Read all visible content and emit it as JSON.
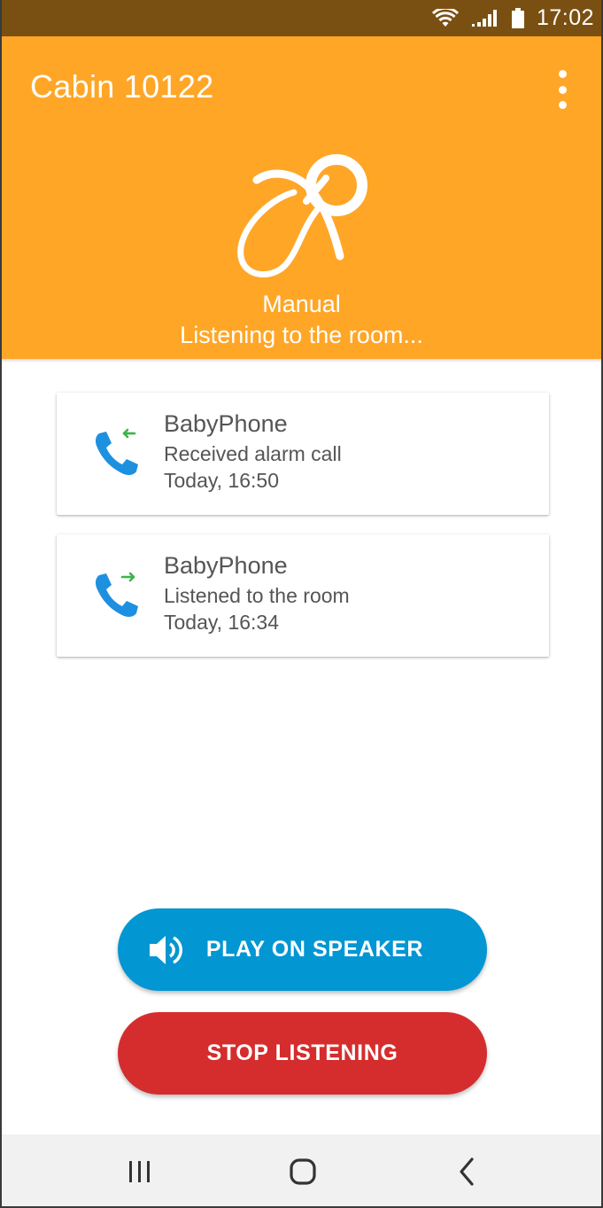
{
  "status_bar": {
    "time": "17:02",
    "icons": [
      "wifi-icon",
      "signal-icon",
      "battery-icon"
    ]
  },
  "header": {
    "title": "Cabin 10122",
    "mode": "Manual",
    "status": "Listening to the room...",
    "icon": "pacifier-icon",
    "background_color": "#ffa627"
  },
  "calls": [
    {
      "name": "BabyPhone",
      "description": "Received alarm call",
      "time": "Today, 16:50",
      "direction": "incoming",
      "icon": "incoming-call-icon"
    },
    {
      "name": "BabyPhone",
      "description": "Listened to the room",
      "time": "Today, 16:34",
      "direction": "outgoing",
      "icon": "outgoing-call-icon"
    }
  ],
  "buttons": {
    "speaker_label": "PLAY ON SPEAKER",
    "speaker_color": "#0296d3",
    "stop_label": "STOP LISTENING",
    "stop_color": "#d52d2d"
  },
  "nav_bar": {
    "items": [
      "recents-icon",
      "home-icon",
      "back-icon"
    ]
  }
}
